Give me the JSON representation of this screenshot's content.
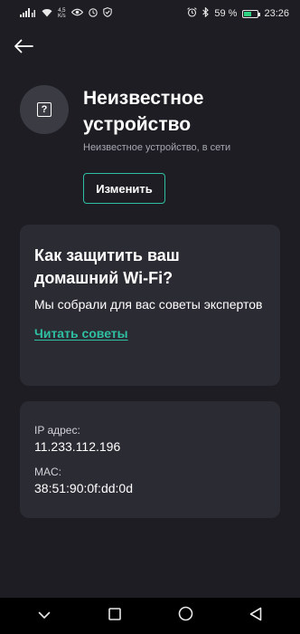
{
  "status_bar": {
    "net_speed_value": "4,5",
    "net_speed_unit": "K/s",
    "battery_percent": "59 %",
    "battery_level": 0.59,
    "time": "23:26",
    "icons": [
      "cellular-signal-icon",
      "wifi-icon",
      "eye-icon",
      "clock-icon",
      "shield-check-icon",
      "alarm-icon",
      "bluetooth-icon",
      "battery-icon"
    ]
  },
  "header": {
    "back_icon": "arrow-left-icon"
  },
  "device": {
    "icon": "unknown-device-icon",
    "icon_glyph": "?",
    "title": "Неизвестное устройство",
    "subtitle": "Неизвестное устройство, в сети",
    "edit_label": "Изменить"
  },
  "tips_card": {
    "title": "Как защитить ваш домашний Wi-Fi?",
    "description": "Мы собрали для вас советы экспертов",
    "link_label": "Читать советы"
  },
  "info_card": {
    "ip_label": "IP адрес:",
    "ip_value": "11.233.112.196",
    "mac_label": "MAC:",
    "mac_value": "38:51:90:0f:dd:0d"
  },
  "nav_bar": {
    "items": [
      "chevron-down-icon",
      "recent-apps-icon",
      "home-icon",
      "back-triangle-icon"
    ]
  },
  "colors": {
    "background": "#1d1d23",
    "card": "#2b2b33",
    "accent": "#2fbfa2",
    "avatar": "#3b3b44",
    "subtitle": "#a7a7b0"
  }
}
